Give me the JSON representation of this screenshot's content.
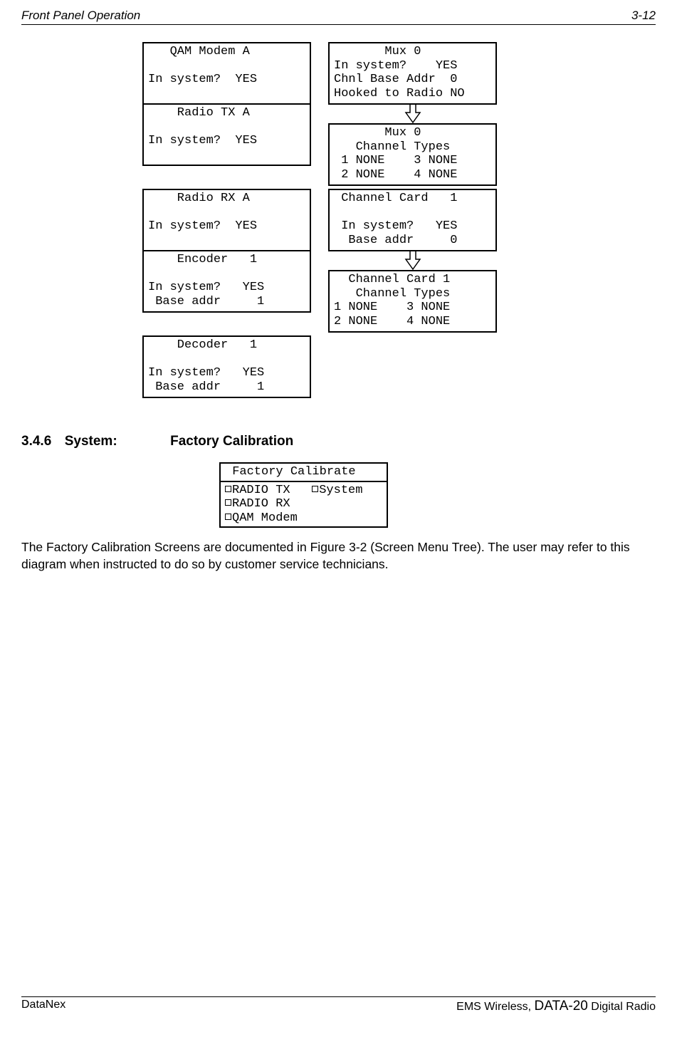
{
  "header": {
    "left": "Front Panel Operation",
    "right": "3-12"
  },
  "boxes": {
    "qam_modem_a": {
      "title": "   QAM Modem A",
      "line2": "",
      "line3": "In system?  YES",
      "line4": ""
    },
    "mux0_a": {
      "title": "       Mux 0",
      "line2": "In system?    YES",
      "line3": "Chnl Base Addr  0",
      "line4": "Hooked to Radio NO"
    },
    "radio_tx_a": {
      "title": "    Radio TX A",
      "line2": "",
      "line3": "In system?  YES",
      "line4": ""
    },
    "mux0_types": {
      "title": "       Mux 0",
      "line2": "   Channel Types",
      "line3": " 1 NONE    3 NONE",
      "line4": " 2 NONE    4 NONE"
    },
    "radio_rx_a": {
      "title": "    Radio RX A",
      "line2": "",
      "line3": "In system?  YES",
      "line4": ""
    },
    "channel_card_1a": {
      "title": " Channel Card   1",
      "line2": "",
      "line3": " In system?   YES",
      "line4": "  Base addr     0"
    },
    "encoder_1": {
      "title": "    Encoder   1",
      "line2": "",
      "line3": "In system?   YES",
      "line4": " Base addr     1"
    },
    "channel_card_1_types": {
      "title": "  Channel Card 1",
      "line2": "   Channel Types",
      "line3": "1 NONE    3 NONE",
      "line4": "2 NONE    4 NONE"
    },
    "decoder_1": {
      "title": "    Decoder   1",
      "line2": "",
      "line3": "In system?   YES",
      "line4": " Base addr     1"
    }
  },
  "section": {
    "number": "3.4.6",
    "label": "System:",
    "title": "Factory Calibration"
  },
  "calibrate": {
    "header": " Factory Calibrate",
    "items": {
      "radio_tx": "RADIO TX",
      "system": "System",
      "radio_rx": "RADIO RX",
      "qam_modem": "QAM Modem"
    }
  },
  "body_paragraph": "The Factory Calibration Screens are documented in Figure 3-2 (Screen Menu Tree).  The user may refer to this diagram when instructed to do so by customer service technicians.",
  "footer": {
    "left": "DataNex",
    "right_prefix": "EMS Wireless, ",
    "right_big": "DATA-20",
    "right_suffix": " Digital Radio"
  }
}
